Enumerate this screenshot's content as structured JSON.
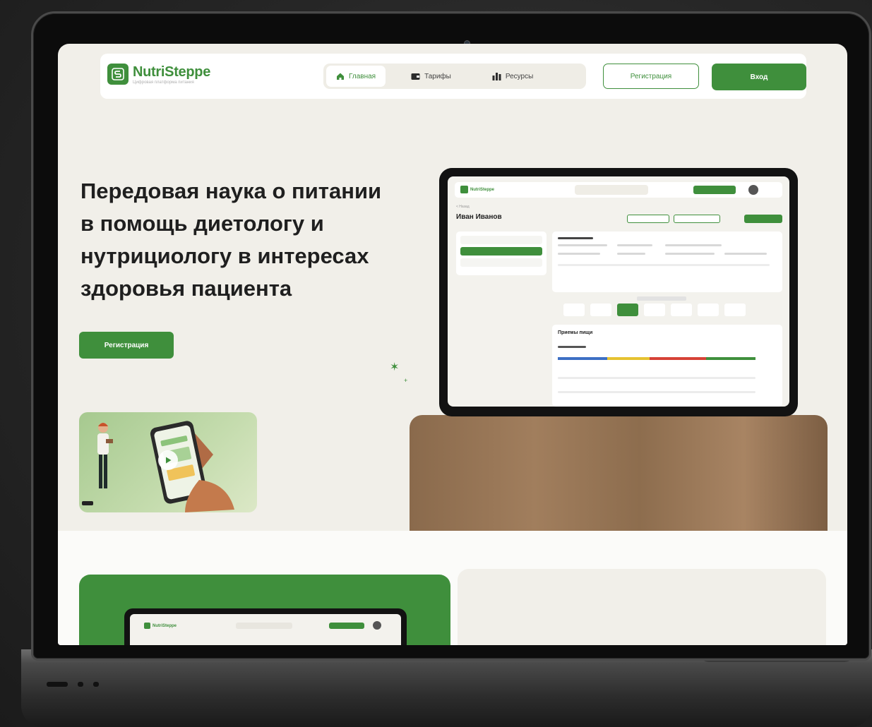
{
  "brand": {
    "name": "NutriSteppe",
    "tagline": "Цифровая платформа питания",
    "color": "#3f8f3c"
  },
  "nav": {
    "items": [
      {
        "label": "Главная",
        "icon": "home-icon",
        "active": true
      },
      {
        "label": "Тарифы",
        "icon": "wallet-icon",
        "active": false
      },
      {
        "label": "Ресурсы",
        "icon": "chart-icon",
        "active": false
      }
    ],
    "register_label": "Регистрация",
    "login_label": "Вход"
  },
  "hero": {
    "title_lines": [
      "Передовая наука о питании",
      "в помощь диетологу и",
      "нутрициологу в интересах",
      "здоровья пациента"
    ],
    "cta_label": "Регистрация",
    "video_icon": "play-icon"
  },
  "tablet": {
    "brand": "NutriSteppe",
    "breadcrumb": "< Назад",
    "patient_name": "Иван Иванов",
    "meals_title": "Приемы пищи"
  },
  "mini_tablet": {
    "brand": "NutriSteppe"
  }
}
